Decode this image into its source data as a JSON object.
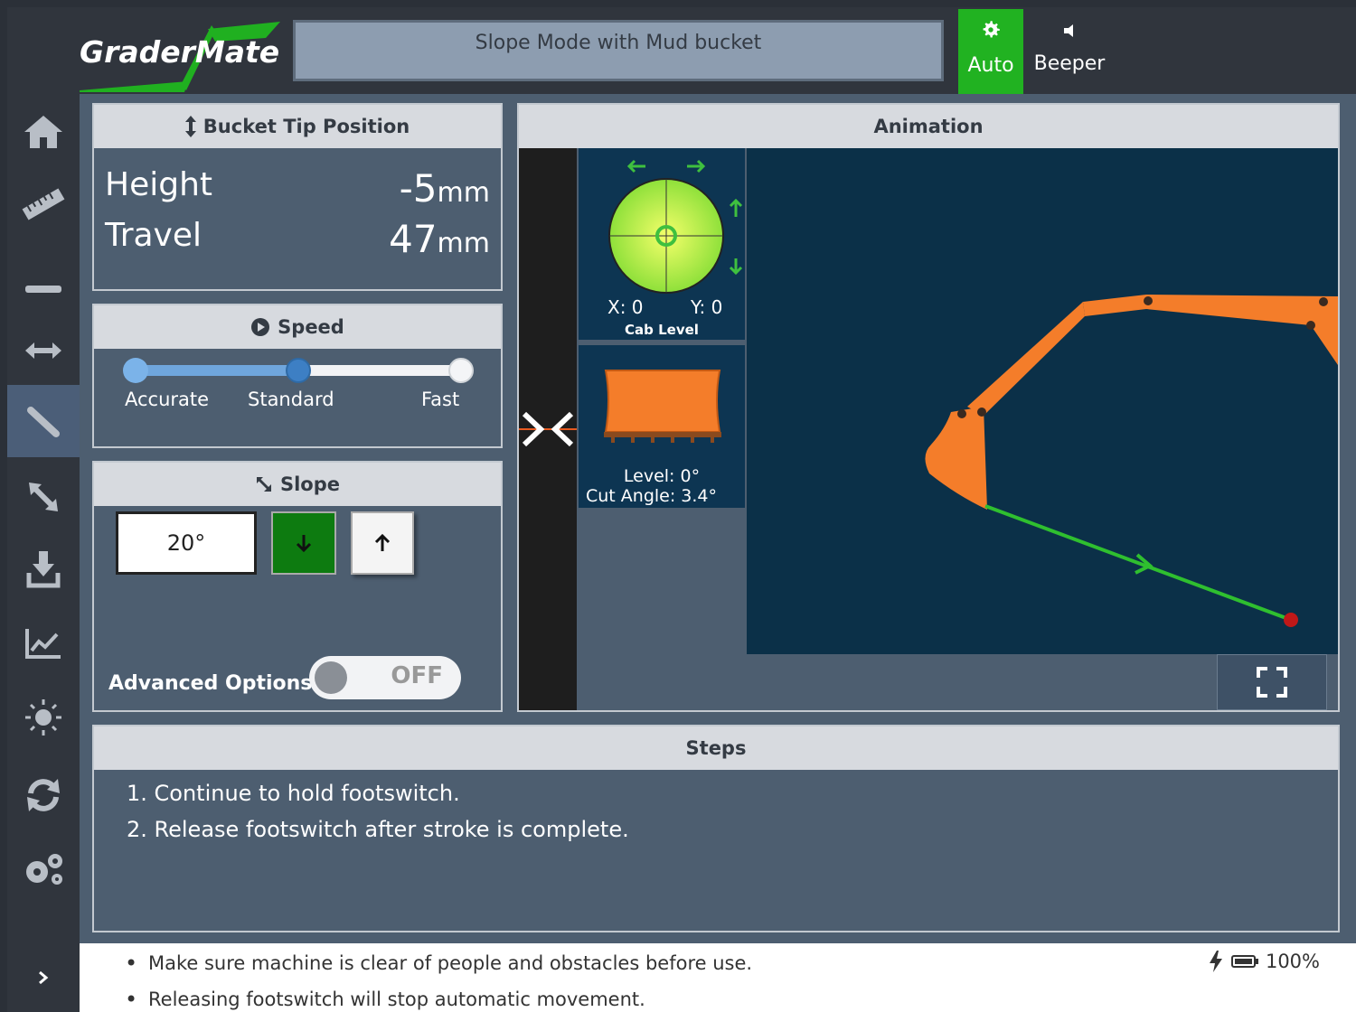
{
  "header": {
    "logo": "GraderMate",
    "mode": "Slope Mode with Mud bucket",
    "auto_label": "Auto",
    "beeper_label": "Beeper"
  },
  "sidebar": {
    "items": [
      {
        "icon": "home-icon"
      },
      {
        "icon": "ruler-icon"
      },
      {
        "icon": "horizontal-line-icon"
      },
      {
        "icon": "horizontal-arrows-icon"
      },
      {
        "icon": "slope-line-icon",
        "active": true
      },
      {
        "icon": "diagonal-arrows-icon"
      },
      {
        "icon": "download-icon"
      },
      {
        "icon": "chart-icon"
      },
      {
        "icon": "brightness-icon"
      },
      {
        "icon": "sync-icon"
      },
      {
        "icon": "settings-icon"
      }
    ],
    "expand_icon": "chevron-right-icon"
  },
  "bucket_tip": {
    "title": "Bucket Tip Position",
    "height_label": "Height",
    "height_value": "-5",
    "height_unit": "mm",
    "travel_label": "Travel",
    "travel_value": "47",
    "travel_unit": "mm"
  },
  "speed": {
    "title": "Speed",
    "options": [
      "Accurate",
      "Standard",
      "Fast"
    ],
    "selected": "Standard"
  },
  "slope": {
    "title": "Slope",
    "value": "20°",
    "down_direction_selected": true,
    "advanced_label": "Advanced Options",
    "advanced_state": "OFF"
  },
  "animation": {
    "title": "Animation",
    "cab_x": "X: 0",
    "cab_y": "Y: 0",
    "cab_title": "Cab Level",
    "level": "Level: 0°",
    "cut_angle": "Cut Angle: 3.4°"
  },
  "steps": {
    "title": "Steps",
    "items": [
      "1. Continue to hold footswitch.",
      "2. Release footswitch after stroke is complete."
    ]
  },
  "footer": {
    "notes": [
      "Make sure machine is clear of people and obstacles before use.",
      "Releasing footswitch will stop automatic movement."
    ],
    "battery": "100%"
  },
  "colors": {
    "accent_green": "#21b221",
    "machine_orange": "#f47d2a",
    "panel_bg": "#4d5e70"
  }
}
